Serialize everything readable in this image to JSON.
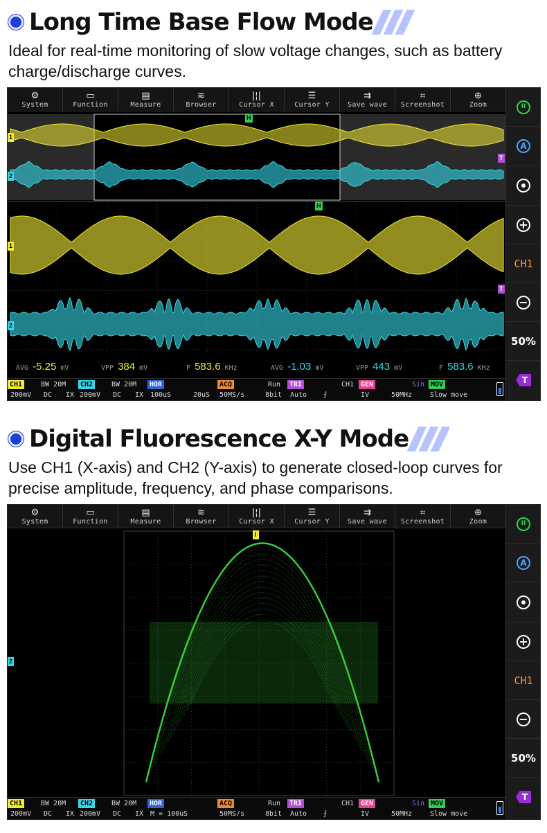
{
  "sections": [
    {
      "heading": "Long Time Base Flow Mode",
      "description": "Ideal for real-time monitoring of slow voltage changes, such as battery charge/discharge curves.",
      "menu": [
        {
          "icon": "gear-icon",
          "glyph": "⚙",
          "label": "System"
        },
        {
          "icon": "function-icon",
          "glyph": "▭",
          "label": "Function"
        },
        {
          "icon": "measure-icon",
          "glyph": "▤",
          "label": "Measure"
        },
        {
          "icon": "browser-icon",
          "glyph": "≋",
          "label": "Browser"
        },
        {
          "icon": "cursor-x-icon",
          "glyph": "|¦|",
          "label": "Cursor X"
        },
        {
          "icon": "cursor-y-icon",
          "glyph": "☰",
          "label": "Cursor Y"
        },
        {
          "icon": "save-wave-icon",
          "glyph": "⇉",
          "label": "Save wave"
        },
        {
          "icon": "screenshot-icon",
          "glyph": "⌗",
          "label": "Screenshot"
        },
        {
          "icon": "zoom-icon",
          "glyph": "⊕",
          "label": "Zoom"
        }
      ],
      "sidebar": {
        "pause": "II",
        "auto": "A",
        "ch": "CH1",
        "pct": "50%",
        "trigger": "T"
      },
      "measurements": {
        "ch1": {
          "avg_label": "AVG",
          "avg": "-5.25",
          "avg_unit": "mV",
          "vpp_label": "VPP",
          "vpp": "384",
          "vpp_unit": "mV",
          "f_label": "F",
          "f": "583.6",
          "f_unit": "KHz"
        },
        "ch2": {
          "avg_label": "AVG",
          "avg": "-1.03",
          "avg_unit": "mV",
          "vpp_label": "VPP",
          "vpp": "443",
          "vpp_unit": "mV",
          "f_label": "F",
          "f": "583.6",
          "f_unit": "KHz"
        }
      },
      "status": {
        "ch1_tag": "CH1",
        "ch1_bw": "BW 20M",
        "ch1_scale": "200mV",
        "ch1_coupling": "DC",
        "ch1_probe": "IX",
        "ch2_tag": "CH2",
        "ch2_bw": "BW 20M",
        "ch2_scale": "200mV",
        "ch2_coupling": "DC",
        "ch2_probe": "IX",
        "hor_tag": "HOR",
        "hor_value": "100uS",
        "hor_extra": "20uS",
        "acq_tag": "ACQ",
        "acq_state": "Run",
        "acq_rate": "50MS/s",
        "acq_bits": "8bit",
        "tri_tag": "TRI",
        "tri_src": "CH1",
        "tri_mode": "Auto",
        "tri_edge": "⨍",
        "gen_tag": "GEN",
        "gen_wave": "Sin",
        "gen_amp": "IV",
        "gen_freq": "50MHz",
        "mov_tag": "MOV",
        "mov_value": "Slow move"
      },
      "markers": {
        "ch1": "1",
        "ch2": "2",
        "trig": "H",
        "t_marker": "T"
      }
    },
    {
      "heading": "Digital Fluorescence X-Y Mode",
      "description": "Use CH1 (X-axis) and CH2 (Y-axis) to generate closed-loop curves for precise amplitude, frequency, and phase comparisons.",
      "sidebar": {
        "pause": "II",
        "auto": "A",
        "ch": "CH1",
        "pct": "50%",
        "trigger": "T"
      },
      "status": {
        "ch1_tag": "CH1",
        "ch1_bw": "BW 20M",
        "ch1_scale": "200mV",
        "ch1_coupling": "DC",
        "ch1_probe": "IX",
        "ch2_tag": "CH2",
        "ch2_bw": "BW 20M",
        "ch2_scale": "200mV",
        "ch2_coupling": "DC",
        "ch2_probe": "IX",
        "hor_tag": "HOR",
        "hor_value": "M = 100uS",
        "hor_extra": "",
        "acq_tag": "ACQ",
        "acq_state": "Run",
        "acq_rate": "50MS/s",
        "acq_bits": "8bit",
        "tri_tag": "TRI",
        "tri_src": "CH1",
        "tri_mode": "Auto",
        "tri_edge": "⨍",
        "gen_tag": "GEN",
        "gen_wave": "Sin",
        "gen_amp": "IV",
        "gen_freq": "50MHz",
        "mov_tag": "MOV",
        "mov_value": "Slow move"
      },
      "markers": {
        "ch2": "2",
        "trig": "I"
      }
    }
  ],
  "colors": {
    "ch1": "#f2ea33",
    "ch2": "#35d7e6",
    "xy": "#3ee03e",
    "accent": "#1d3fd6",
    "hor": "#2b62d9",
    "acq": "#f08a2a",
    "tri": "#b34ed8",
    "gen": "#e8408a",
    "mov": "#33cc55"
  }
}
